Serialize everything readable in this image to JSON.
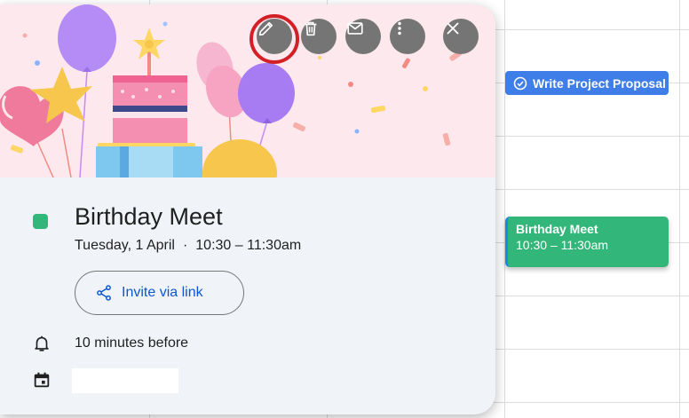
{
  "calendar": {
    "task_chip": {
      "label": "Write Project Proposal"
    },
    "event_chip": {
      "title": "Birthday Meet",
      "time": "10:30 – 11:30am"
    }
  },
  "popup": {
    "toolbar": {
      "edit": "edit-icon",
      "delete": "trash-icon",
      "email": "mail-icon",
      "more": "more-vert-icon",
      "close": "close-icon"
    },
    "event": {
      "title": "Birthday Meet",
      "date": "Tuesday, 1 April",
      "separator": "·",
      "time": "10:30 – 11:30am",
      "color": "#33b679"
    },
    "invite_button": {
      "label": "Invite via link"
    },
    "reminder": {
      "text": "10 minutes before"
    },
    "calendar_name": {
      "text": ""
    }
  },
  "colors": {
    "task_chip": "#3f7ee8",
    "event_chip": "#33b679",
    "link_blue": "#0b57d0",
    "highlight_ring": "#d32027"
  }
}
